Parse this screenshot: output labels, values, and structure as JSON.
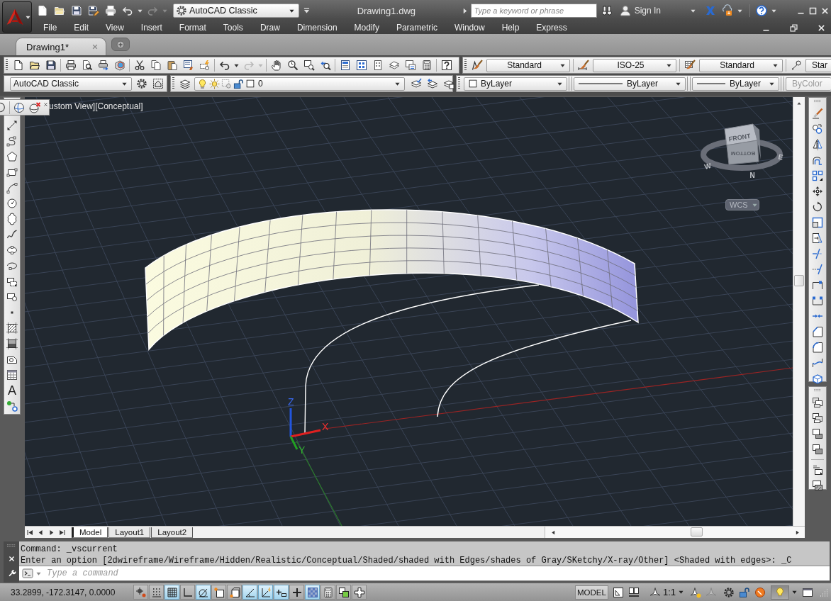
{
  "title_bar": {
    "undo": {
      "disabled": false
    },
    "redo": {
      "disabled": true
    },
    "workspace": "AutoCAD Classic",
    "title": "Drawing1.dwg",
    "search": {
      "placeholder": "Type a keyword or phrase"
    },
    "sign_in": "Sign In"
  },
  "menu": [
    {
      "label": "File"
    },
    {
      "label": "Edit"
    },
    {
      "label": "View"
    },
    {
      "label": "Insert"
    },
    {
      "label": "Format"
    },
    {
      "label": "Tools"
    },
    {
      "label": "Draw"
    },
    {
      "label": "Dimension"
    },
    {
      "label": "Modify"
    },
    {
      "label": "Parametric"
    },
    {
      "label": "Window"
    },
    {
      "label": "Help"
    },
    {
      "label": "Express"
    }
  ],
  "document_tabs": [
    {
      "label": "Drawing1*",
      "selected": true
    }
  ],
  "standard_toolbar": {
    "undo": {
      "disabled": false
    },
    "redo": {
      "disabled": true
    }
  },
  "styles_toolbar": {
    "text_style": "Standard",
    "dimension_style": "ISO-25",
    "table_style": "Standard",
    "multileader_style": "Star"
  },
  "workspaces_toolbar": {
    "workspace": "AutoCAD Classic"
  },
  "layers_toolbar": {
    "layer": "0"
  },
  "properties_toolbar": {
    "color_setting": "ByLayer",
    "linetype": "ByLayer",
    "lineweight": "ByLayer",
    "plot_style": {
      "value": "ByColor",
      "disabled": true
    }
  },
  "draw_toolbar": {
    "text_tool": "A"
  },
  "viewport": {
    "label": "ustom View][Conceptual]",
    "ucs_icon": {
      "x": "X",
      "y": "Y",
      "z": "Z"
    },
    "viewcube": {
      "top_face": "FRONT",
      "bottom_face": "BOTTOM",
      "west": "W",
      "east": "E",
      "north": "N"
    },
    "ucs_menu": "WCS"
  },
  "layout_tabs": [
    {
      "label": "Model",
      "selected": true
    },
    {
      "label": "Layout1",
      "selected": false
    },
    {
      "label": "Layout2",
      "selected": false
    }
  ],
  "command_line": {
    "history": [
      "Command: _vscurrent",
      "Enter an option [2dwireframe/Wireframe/Hidden/Realistic/Conceptual/Shaded/shaded with Edges/shades of Gray/SKetchy/X-ray/Other] <Shaded with edges>: _C"
    ],
    "placeholder": "Type a command"
  },
  "status_bar": {
    "coordinates": "33.2899, -172.3147, 0.0000",
    "toggles": [
      {
        "on": false
      },
      {
        "on": false
      },
      {
        "on": true
      },
      {
        "on": false
      },
      {
        "on": true
      },
      {
        "on": false
      },
      {
        "on": false
      },
      {
        "on": true
      },
      {
        "on": true
      },
      {
        "on": true
      },
      {
        "on": false
      },
      {
        "on": true
      },
      {
        "on": false
      },
      {
        "on": false
      },
      {
        "on": false
      }
    ],
    "space": "MODEL",
    "annotation_scale": "1:1"
  }
}
